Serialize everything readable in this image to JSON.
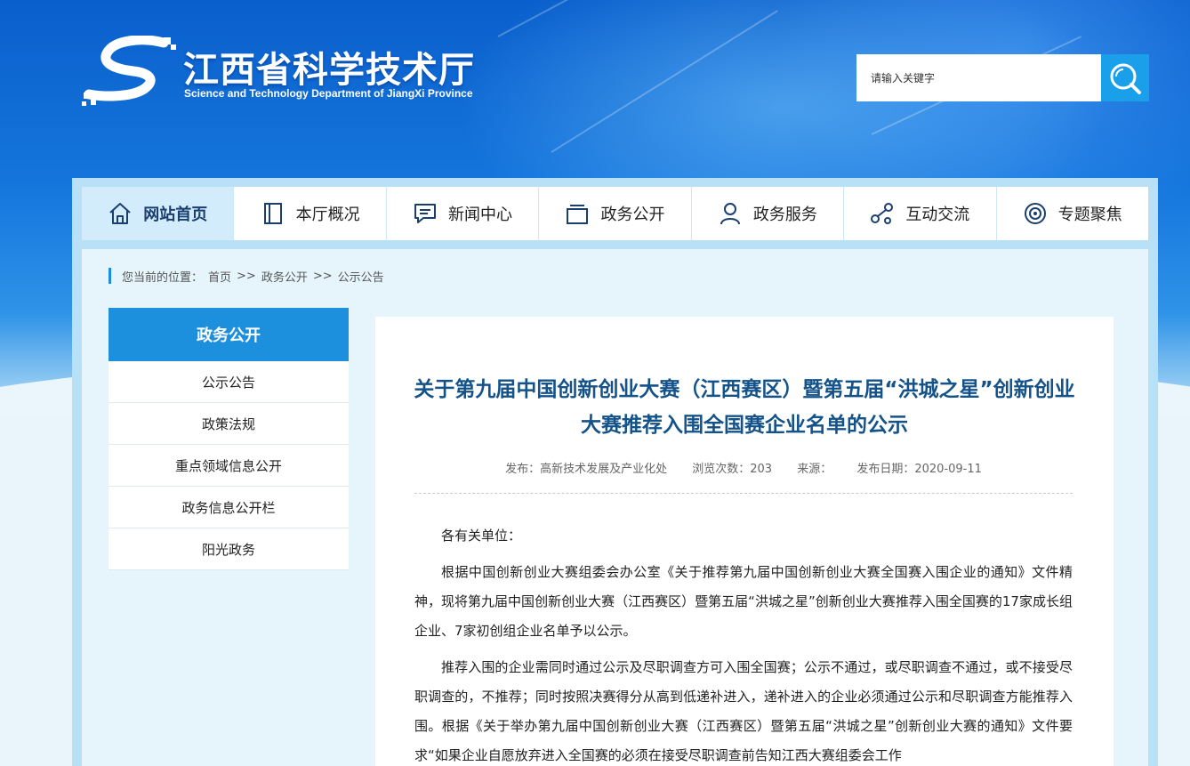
{
  "site": {
    "name_cn": "江西省科学技术厅",
    "name_en": "Science and Technology Department of JiangXi Province"
  },
  "search": {
    "placeholder": "请输入关键字",
    "icon": "search-icon"
  },
  "nav": [
    {
      "label": "网站首页",
      "icon": "home-icon",
      "active": true
    },
    {
      "label": "本厅概况",
      "icon": "book-icon",
      "active": false
    },
    {
      "label": "新闻中心",
      "icon": "chat-icon",
      "active": false
    },
    {
      "label": "政务公开",
      "icon": "folder-icon",
      "active": false
    },
    {
      "label": "政务服务",
      "icon": "person-icon",
      "active": false
    },
    {
      "label": "互动交流",
      "icon": "share-icon",
      "active": false
    },
    {
      "label": "专题聚焦",
      "icon": "target-icon",
      "active": false
    }
  ],
  "breadcrumb": {
    "prefix": "您当前的位置：",
    "items": [
      "首页",
      "政务公开",
      "公示公告"
    ],
    "separator": ">>"
  },
  "sidebar": {
    "title": "政务公开",
    "items": [
      "公示公告",
      "政策法规",
      "重点领域信息公开",
      "政务信息公开栏",
      "阳光政务"
    ]
  },
  "article": {
    "title": "关于第九届中国创新创业大赛（江西赛区）暨第五届“洪城之星”创新创业大赛推荐入围全国赛企业名单的公示",
    "meta": {
      "publisher": "发布：高新技术发展及产业化处",
      "views": "浏览次数：203",
      "source": "来源：",
      "date": "发布日期：2020-09-11"
    },
    "salutation": "各有关单位：",
    "paragraphs": [
      "根据中国创新创业大赛组委会办公室《关于推荐第九届中国创新创业大赛全国赛入围企业的通知》文件精神，现将第九届中国创新创业大赛（江西赛区）暨第五届“洪城之星”创新创业大赛推荐入围全国赛的17家成长组企业、7家初创组企业名单予以公示。",
      "推荐入围的企业需同时通过公示及尽职调查方可入围全国赛；公示不通过，或尽职调查不通过，或不接受尽职调查的，不推荐；同时按照决赛得分从高到低递补进入，递补进入的企业必须通过公示和尽职调查方能推荐入围。根据《关于举办第九届中国创新创业大赛（江西赛区）暨第五届“洪城之星”创新创业大赛的通知》文件要求“如果企业自愿放弃进入全国赛的必须在接受尽职调查前告知江西大赛组委会工作"
    ]
  },
  "colors": {
    "accent": "#1d90dd",
    "title": "#14528a",
    "nav_active_bg": "#d3ecfb"
  }
}
